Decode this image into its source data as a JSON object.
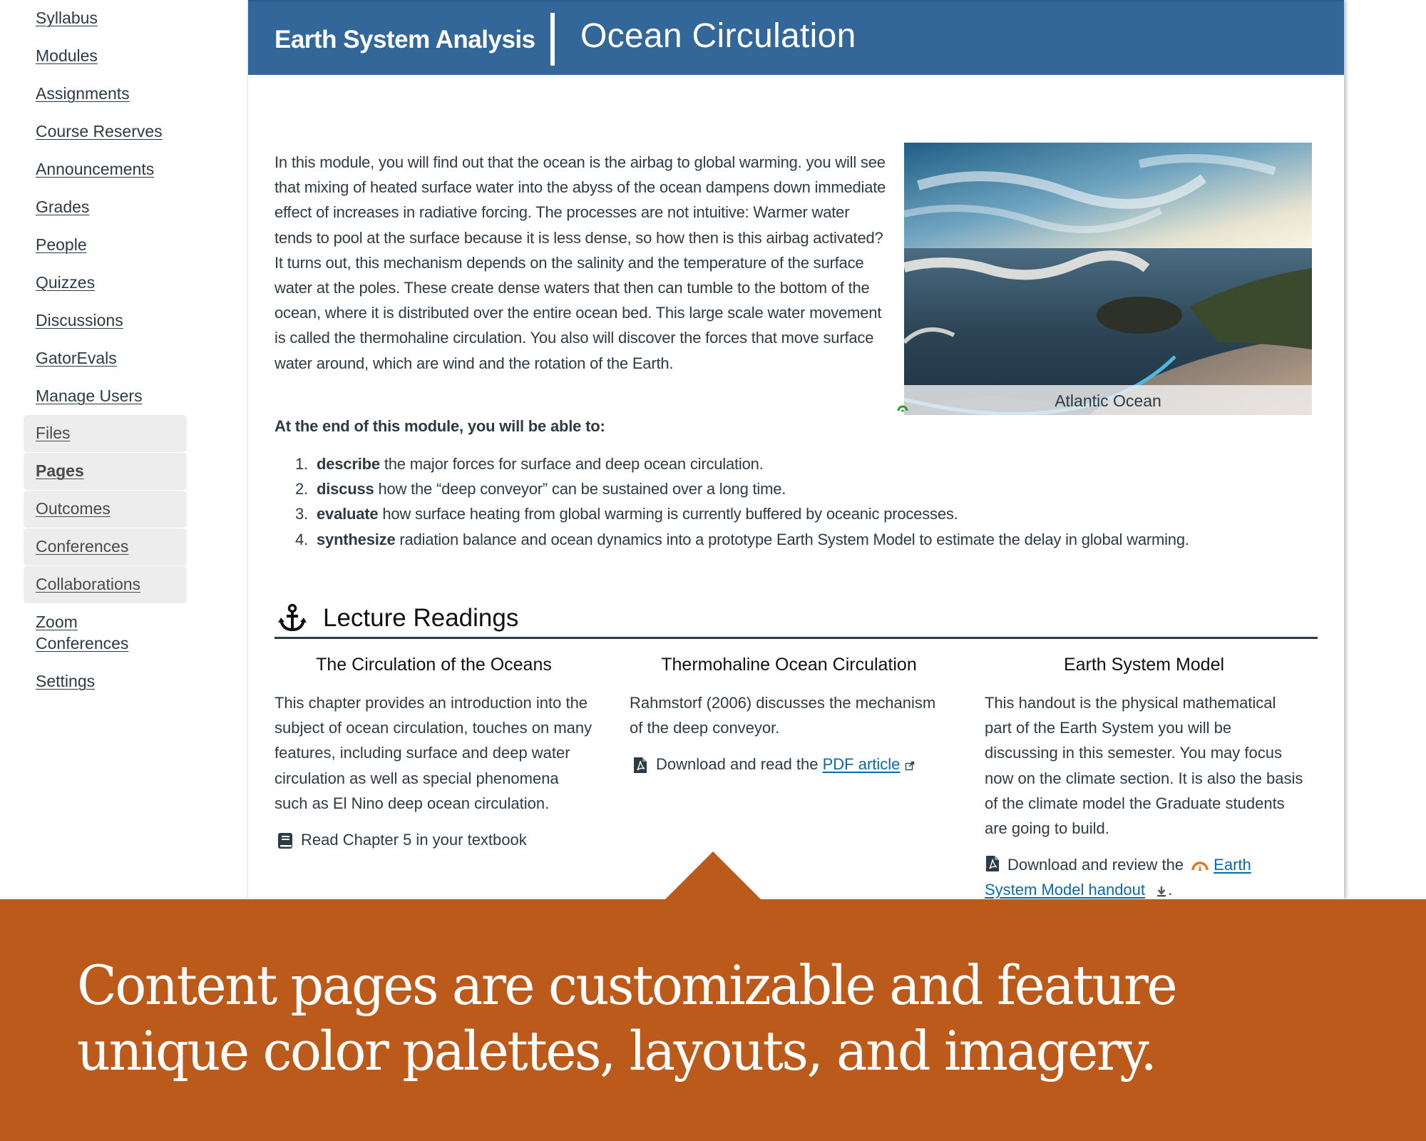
{
  "sidebar": {
    "items": [
      {
        "label": "Syllabus",
        "hidden": false,
        "active": false
      },
      {
        "label": "Modules",
        "hidden": false,
        "active": false
      },
      {
        "label": "Assignments",
        "hidden": false,
        "active": false
      },
      {
        "label": "Course Reserves",
        "hidden": false,
        "active": false
      },
      {
        "label": "Announcements",
        "hidden": false,
        "active": false
      },
      {
        "label": "Grades",
        "hidden": false,
        "active": false
      },
      {
        "label": "People",
        "hidden": false,
        "active": false
      },
      {
        "label": "Quizzes",
        "hidden": false,
        "active": false
      },
      {
        "label": "Discussions",
        "hidden": false,
        "active": false
      },
      {
        "label": "GatorEvals",
        "hidden": false,
        "active": false
      },
      {
        "label": "Manage Users",
        "hidden": false,
        "active": false
      },
      {
        "label": "Files",
        "hidden": true,
        "active": false
      },
      {
        "label": "Pages",
        "hidden": true,
        "active": true
      },
      {
        "label": "Outcomes",
        "hidden": true,
        "active": false
      },
      {
        "label": "Conferences",
        "hidden": true,
        "active": false
      },
      {
        "label": "Collaborations",
        "hidden": true,
        "active": false
      },
      {
        "label": "Zoom Conferences",
        "hidden": false,
        "active": false
      },
      {
        "label": "Settings",
        "hidden": false,
        "active": false
      }
    ]
  },
  "header": {
    "course_name": "Earth System Analysis",
    "page_title": "Ocean Circulation",
    "color": "#336699"
  },
  "intro": {
    "paragraph": "In this module, you will find out that the ocean is the airbag to global warming. you will see that mixing of heated surface water into the abyss of the ocean dampens down immediate effect of increases in radiative forcing. The processes are not intuitive: Warmer water tends to pool at the surface because it is less dense, so how then is this airbag activated? It turns out, this mechanism depends on the salinity and the temperature of the surface water at the poles. These create dense waters that then can tumble to the bottom of the ocean, where it is distributed over the entire ocean bed. This large scale water movement is called the thermohaline circulation. You also will discover the forces that move surface water around, which are wind and the rotation of the Earth.",
    "image_caption": "Atlantic Ocean",
    "image_icon": "ocean-beach-photo"
  },
  "objectives": {
    "heading": "At the end of this module, you will be able to:",
    "items": [
      {
        "num": "1.",
        "verb": "describe",
        "text": " the major forces for surface and deep ocean circulation."
      },
      {
        "num": "2.",
        "verb": "discuss",
        "text": " how the “deep conveyor” can be sustained over a long time."
      },
      {
        "num": "3.",
        "verb": "evaluate",
        "text": " how surface heating from global warming is currently buffered by oceanic processes."
      },
      {
        "num": "4.",
        "verb": "synthesize",
        "text": " radiation balance and ocean dynamics into a prototype Earth System Model to estimate the delay in global warming."
      }
    ]
  },
  "readings": {
    "section_title": "Lecture Readings",
    "section_icon": "anchor-icon",
    "columns": [
      {
        "title": "The Circulation of the Oceans",
        "description": "This chapter provides an introduction into the subject of ocean circulation, touches on many features, including surface and deep water circulation as well as special phenomena such as El Nino deep ocean circulation.",
        "action_icon": "book-icon",
        "action_text": "Read Chapter 5 in your textbook"
      },
      {
        "title": "Thermohaline Ocean Circulation",
        "description": "Rahmstorf (2006) discusses the mechanism of the deep conveyor.",
        "action_icon": "pdf-file-icon",
        "action_text": "Download and read the ",
        "link_text": "PDF article",
        "link_suffix_icon": "external-link-icon"
      },
      {
        "title": "Earth System Model",
        "description": "This handout is the physical mathematical part of the Earth System you will be discussing in this semester. You may focus now on the climate section. It is also the basis of the climate model the Graduate students are going to build.",
        "action_icon": "pdf-file-icon",
        "action_text": "Download and review the ",
        "link_prefix_icon": "accessibility-gauge-icon",
        "link_text": "Earth System Model handout",
        "link_suffix_icon": "download-icon",
        "trailing": "."
      }
    ]
  },
  "banner": {
    "text": "Content pages are customizable and feature unique color palettes, layouts, and imagery.",
    "color": "#bc5a1b"
  }
}
